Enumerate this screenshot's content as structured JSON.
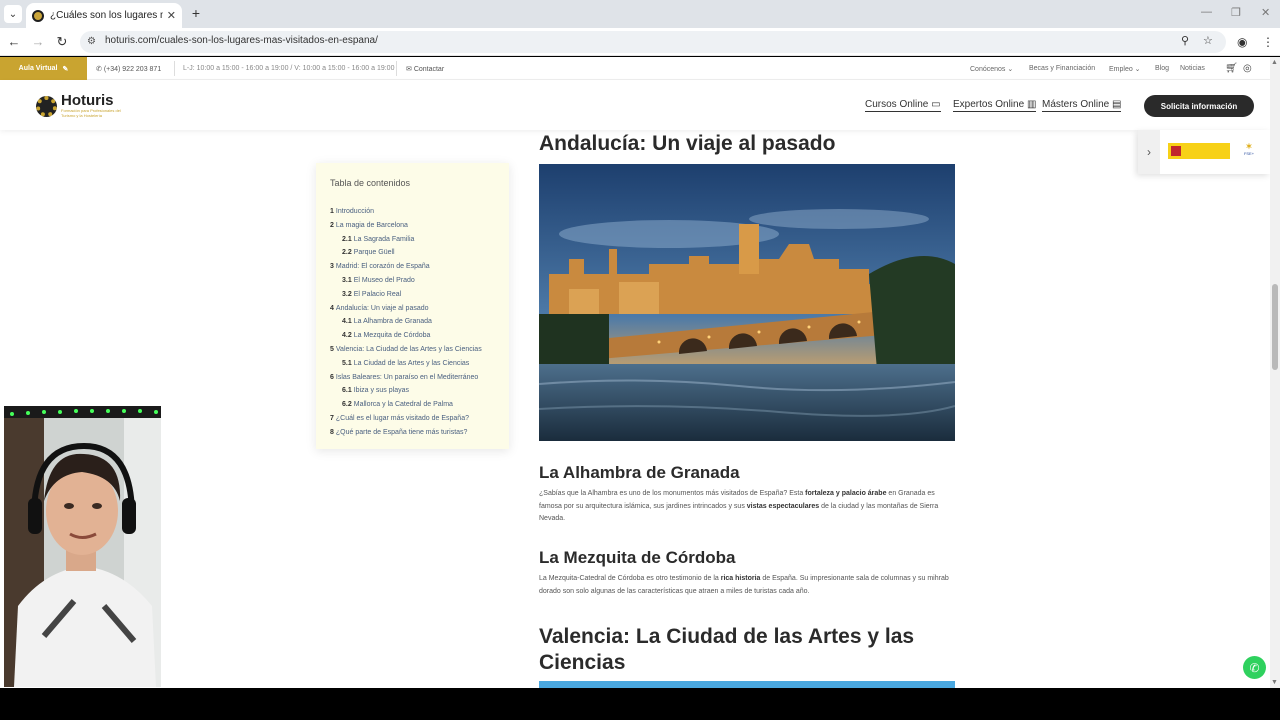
{
  "browser": {
    "tab_title": "¿Cuáles son los lugares más visi",
    "url": "hoturis.com/cuales-son-los-lugares-mas-visitados-en-espana/",
    "icons": [
      "back-icon",
      "forward-icon",
      "reload-icon",
      "site-info-icon",
      "zoom-icon",
      "bookmark-star-icon",
      "profile-icon",
      "menu-icon"
    ]
  },
  "topbar": {
    "aula": "Aula Virtual",
    "phone": "(+34) 922 203 871",
    "hours": "L-J: 10:00 a 15:00 - 16:00 a 19:00 / V: 10:00 a 15:00 - 16:00 a 19:00",
    "contact": "Contactar",
    "links": [
      "Conócenos",
      "Becas y Financiación",
      "Empleo",
      "Blog",
      "Noticias"
    ]
  },
  "header": {
    "brand": "Hoturis",
    "brand_sub": "Formación para Profesionales del Turismo y la Hostelería",
    "nav": [
      "Cursos Online",
      "Expertos Online",
      "Másters Online"
    ],
    "cta": "Solicita información"
  },
  "toc": {
    "title": "Tabla de contenidos",
    "items": [
      {
        "num": "1",
        "label": "Introducción"
      },
      {
        "num": "2",
        "label": "La magia de Barcelona"
      },
      {
        "num": "2.1",
        "label": "La Sagrada Familia"
      },
      {
        "num": "2.2",
        "label": "Parque Güell"
      },
      {
        "num": "3",
        "label": "Madrid: El corazón de España"
      },
      {
        "num": "3.1",
        "label": "El Museo del Prado"
      },
      {
        "num": "3.2",
        "label": "El Palacio Real"
      },
      {
        "num": "4",
        "label": "Andalucía: Un viaje al pasado"
      },
      {
        "num": "4.1",
        "label": "La Alhambra de Granada"
      },
      {
        "num": "4.2",
        "label": "La Mezquita de Córdoba"
      },
      {
        "num": "5",
        "label": "Valencia: La Ciudad de las Artes y las Ciencias"
      },
      {
        "num": "5.1",
        "label": "La Ciudad de las Artes y las Ciencias"
      },
      {
        "num": "6",
        "label": "Islas Baleares: Un paraíso en el Mediterráneo"
      },
      {
        "num": "6.1",
        "label": "Ibiza y sus playas"
      },
      {
        "num": "6.2",
        "label": "Mallorca y la Catedral de Palma"
      },
      {
        "num": "7",
        "label": "¿Cuál es el lugar más visitado de España?"
      },
      {
        "num": "8",
        "label": "¿Qué parte de España tiene más turistas?"
      }
    ]
  },
  "article": {
    "h_andalucia": "Andalucía: Un viaje al pasado",
    "h_alhambra": "La Alhambra de Granada",
    "p_alhambra_1": "¿Sabías que la Alhambra es uno de los monumentos más visitados de España? Esta ",
    "p_alhambra_b1": "fortaleza y palacio árabe",
    "p_alhambra_2": " en Granada es famosa por su arquitectura islámica, sus jardines intrincados y sus ",
    "p_alhambra_b2": "vistas espectaculares",
    "p_alhambra_3": " de la ciudad y las montañas de Sierra Nevada.",
    "h_mezquita": "La Mezquita de Córdoba",
    "p_mezquita_1": "La Mezquita-Catedral de Córdoba es otro testimonio de la ",
    "p_mezquita_b1": "rica historia",
    "p_mezquita_2": " de España. Su impresionante sala de columnas y su mihrab dorado son solo algunas de las características que atraen a miles de turistas cada año.",
    "h_valencia": "Valencia: La Ciudad de las Artes y las Ciencias"
  },
  "colors": {
    "brand_gold": "#c9a430",
    "cta_dark": "#2a2a2a",
    "toc_bg": "#fdfce8",
    "whatsapp": "#2fd15e"
  }
}
